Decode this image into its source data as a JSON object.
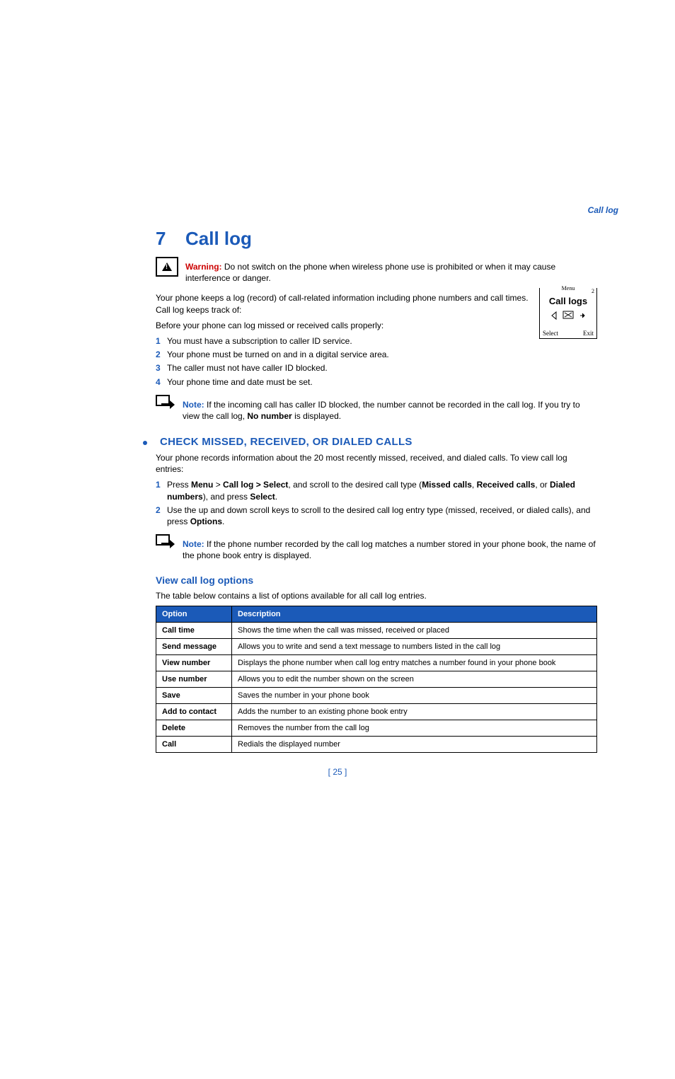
{
  "header": {
    "tag": "Call log"
  },
  "chapter": {
    "num": "7",
    "title": "Call log"
  },
  "warning": {
    "label": "Warning:",
    "text": " Do not switch on the phone when wireless phone use is prohibited or when it may cause interference or danger."
  },
  "intro": {
    "p1": "Your phone keeps a log (record) of call-related information including phone numbers and call times. Call log keeps track of:",
    "p2": "Before your phone can log missed or received calls properly:"
  },
  "req": [
    {
      "n": "1",
      "t": "You must have a subscription to caller ID service."
    },
    {
      "n": "2",
      "t": "Your phone must be turned on and in a digital service area."
    },
    {
      "n": "3",
      "t": "The caller must not have caller ID blocked."
    },
    {
      "n": "4",
      "t": "Your phone time and date must be set."
    }
  ],
  "note1": {
    "label": "Note:",
    "a": " If the incoming call has caller ID blocked, the number cannot be recorded in the call log. If you try to view the call log, ",
    "b": "No number",
    "c": " is displayed."
  },
  "h2": "CHECK MISSED, RECEIVED, OR DIALED CALLS",
  "check": {
    "p": "Your phone records information about the 20 most recently missed, received, and dialed calls. To view call log entries:"
  },
  "steps": [
    {
      "n": "1",
      "pre": "Press ",
      "m": "Menu",
      "gt": " > ",
      "cl": "Call log > Select",
      "mid": ", and scroll to the desired call type (",
      "mc": "Missed calls",
      "c1": ", ",
      "rc": "Received calls",
      "c2": ", or ",
      "dn": "Dialed numbers",
      "post": "), and press ",
      "sel": "Select",
      "end": "."
    },
    {
      "n": "2",
      "pre": "Use the up and down scroll keys to scroll to the desired call log entry type (missed, received, or dialed calls), and press ",
      "opt": "Options",
      "end": "."
    }
  ],
  "note2": {
    "label": "Note:",
    "t": " If the phone number recorded by the call log matches a number stored in your phone book, the name of the phone book entry is displayed."
  },
  "h3": "View call log options",
  "tabcap": "The table below contains a list of options available for all call log entries.",
  "th": {
    "o": "Option",
    "d": "Description"
  },
  "rows": [
    {
      "o": "Call time",
      "d": "Shows the time when the call was missed, received or placed"
    },
    {
      "o": "Send message",
      "d": "Allows you to write and send a text message to numbers listed in the call log"
    },
    {
      "o": "View number",
      "d": "Displays the phone number when call log entry matches a number found in your phone book"
    },
    {
      "o": "Use number",
      "d": "Allows you to edit the number shown on the screen"
    },
    {
      "o": "Save",
      "d": "Saves the number in your phone book"
    },
    {
      "o": "Add to contact",
      "d": "Adds the number to an existing phone book entry"
    },
    {
      "o": "Delete",
      "d": "Removes the number from the call log"
    },
    {
      "o": "Call",
      "d": "Redials the displayed number"
    }
  ],
  "phone": {
    "menu": "Menu",
    "num": "2",
    "title": "Call logs",
    "select": "Select",
    "exit": "Exit"
  },
  "page": "[ 25 ]"
}
